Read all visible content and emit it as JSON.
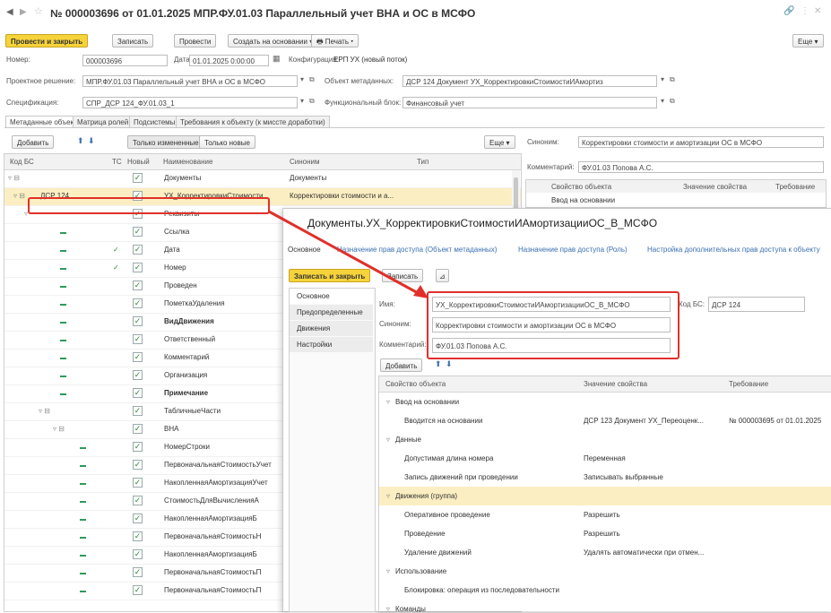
{
  "window": {
    "title": "№ 000003696 от 01.01.2025 МПР.ФУ.01.03 Параллельный учет ВНА и ОС в МСФО",
    "more_label": "Еще ▾"
  },
  "toolbar": {
    "post_close": "Провести и закрыть",
    "save": "Записать",
    "post": "Провести",
    "create_based": "Создать на основании ▾",
    "print": "Печать ▾"
  },
  "header_fields": {
    "number_label": "Номер:",
    "number_value": "000003696",
    "date_label": "Дата:",
    "date_value": "01.01.2025 0:00:00",
    "config_label": "Конфигурация:",
    "config_value": "ЕРП УХ (новый поток)",
    "project_label": "Проектное решение:",
    "project_value": "МПР.ФУ.01.03 Параллельный учет ВНА и ОС в МСФО",
    "metaobject_label": "Объект метаданных:",
    "metaobject_value": "ДСР 124 Документ УХ_КорректировкиСтоимостиИАмортиз",
    "spec_label": "Спецификация:",
    "spec_value": "СПР_ДСР 124_ФУ.01.03_1",
    "functional_block_label": "Функциональный блок:",
    "functional_block_value": "Финансовый учет"
  },
  "tabs": [
    {
      "label": "Метаданные объекта",
      "active": true
    },
    {
      "label": "Матрица ролей",
      "active": false
    },
    {
      "label": "Подсистемы",
      "active": false
    },
    {
      "label": "Требования к объекту (к миссте доработки)",
      "active": false
    }
  ],
  "grid_toolbar": {
    "add": "Добавить",
    "show_changed": "Только измененные",
    "only_new": "Только новые",
    "more": "Еще ▾"
  },
  "grid_headers": {
    "code": "Код БС",
    "ts": "ТС",
    "new": "Новый",
    "name": "Наименование",
    "synonym": "Синоним",
    "type": "Тип"
  },
  "grid_rows": [
    {
      "code": "",
      "mark": "",
      "name": "Документы",
      "synonym": "Документы"
    },
    {
      "code": "ДСР 124",
      "mark": "",
      "name": "УХ_КорректировкиСтоимости",
      "synonym": "Корректировки стоимости и а..."
    },
    {
      "code": "",
      "mark": "",
      "name": "Реквизиты",
      "synonym": ""
    },
    {
      "code": "",
      "mark": "",
      "name": "Ссылка",
      "synonym": ""
    },
    {
      "code": "",
      "mark": "✓",
      "name": "Дата",
      "synonym": ""
    },
    {
      "code": "",
      "mark": "✓",
      "name": "Номер",
      "synonym": ""
    },
    {
      "code": "",
      "mark": "",
      "name": "Проведен",
      "synonym": ""
    },
    {
      "code": "",
      "mark": "",
      "name": "ПометкаУдаления",
      "synonym": ""
    },
    {
      "code": "",
      "mark": "",
      "name": "ВидДвижения",
      "synonym": ""
    },
    {
      "code": "",
      "mark": "",
      "name": "Ответственный",
      "synonym": ""
    },
    {
      "code": "",
      "mark": "",
      "name": "Комментарий",
      "synonym": ""
    },
    {
      "code": "",
      "mark": "",
      "name": "Организация",
      "synonym": ""
    },
    {
      "code": "",
      "mark": "",
      "name": "Примечание",
      "synonym": ""
    },
    {
      "code": "",
      "mark": "",
      "name": "ТабличныеЧасти",
      "synonym": ""
    },
    {
      "code": "",
      "mark": "",
      "name": "ВНА",
      "synonym": ""
    },
    {
      "code": "",
      "mark": "",
      "name": "НомерСтроки",
      "synonym": ""
    },
    {
      "code": "",
      "mark": "",
      "name": "ПервоначальнаяСтоимостьУчет",
      "synonym": ""
    },
    {
      "code": "",
      "mark": "",
      "name": "НакопленнаяАмортизацияУчет",
      "synonym": ""
    },
    {
      "code": "",
      "mark": "",
      "name": "СтоимостьДляВычисленияА",
      "synonym": ""
    },
    {
      "code": "",
      "mark": "",
      "name": "НакопленнаяАмортизацияБ",
      "synonym": ""
    },
    {
      "code": "",
      "mark": "",
      "name": "ПервоначальнаяСтоимостьН",
      "synonym": ""
    },
    {
      "code": "",
      "mark": "",
      "name": "НакопленнаяАмортизацияБ",
      "synonym": ""
    },
    {
      "code": "",
      "mark": "",
      "name": "ПервоначальнаяСтоимостьП",
      "synonym": ""
    },
    {
      "code": "",
      "mark": "",
      "name": "ПервоначальнаяСтоимостьП",
      "synonym": ""
    }
  ],
  "right_panel": {
    "synonym_label": "Синоним:",
    "synonym_value": "Корректировки стоимости и амортизации ОС в МСФО",
    "comment_label": "Комментарий:",
    "comment_value": "ФУ.01.03 Попова А.С.",
    "col_property": "Свойство объекта",
    "col_value": "Значение свойства",
    "col_req": "Требование",
    "first_row": "Ввод на основании"
  },
  "popup": {
    "title": "Документы.УХ_КорректировкиСтоимостиИАмортизацииОС_В_МСФО",
    "links": [
      "Основное",
      "Назначение прав доступа (Объект метаданных)",
      "Назначение прав доступа (Роль)",
      "Настройка дополнительных прав доступа к объекту"
    ],
    "save_close": "Записать и закрыть",
    "save": "Записать",
    "sections": [
      "Основное",
      "Предопределенные",
      "Движения",
      "Настройки"
    ],
    "name_label": "Имя:",
    "name_value": "УХ_КорректировкиСтоимостиИАмортизацииОС_В_МСФО",
    "code_label": "Код БС:",
    "code_value": "ДСР 124",
    "synonym_label": "Синоним:",
    "synonym_value": "Корректировки стоимости и амортизации ОС в МСФО",
    "comment_label": "Комментарий:",
    "comment_value": "ФУ.01.03 Попова А.С.",
    "add": "Добавить",
    "col_property": "Свойство объекта",
    "col_value": "Значение свойства",
    "col_req": "Требование",
    "rows": [
      {
        "level": 0,
        "group": true,
        "prop": "Ввод на основании",
        "value": "",
        "req": ""
      },
      {
        "level": 1,
        "group": false,
        "prop": "Вводится на основании",
        "value": "ДСР 123 Документ УХ_Переоценк...",
        "req": "№ 000003695 от 01.01.2025"
      },
      {
        "level": 0,
        "group": true,
        "prop": "Данные",
        "value": "",
        "req": ""
      },
      {
        "level": 1,
        "group": false,
        "prop": "Допустимая длина номера",
        "value": "Переменная",
        "req": ""
      },
      {
        "level": 1,
        "group": false,
        "prop": "Запись движений при проведении",
        "value": "Записывать выбранные",
        "req": ""
      },
      {
        "level": 0,
        "group": true,
        "prop": "Движения (группа)",
        "value": "",
        "req": "",
        "highlight": true
      },
      {
        "level": 1,
        "group": false,
        "prop": "Оперативное проведение",
        "value": "Разрешить",
        "req": ""
      },
      {
        "level": 1,
        "group": false,
        "prop": "Проведение",
        "value": "Разрешить",
        "req": ""
      },
      {
        "level": 1,
        "group": false,
        "prop": "Удаление движений",
        "value": "Удалять автоматически при отмен...",
        "req": ""
      },
      {
        "level": 0,
        "group": true,
        "prop": "Использование",
        "value": "",
        "req": ""
      },
      {
        "level": 1,
        "group": false,
        "prop": "Блокировка: операция из последовательности",
        "value": "",
        "req": ""
      },
      {
        "level": 0,
        "group": true,
        "prop": "Команды",
        "value": "",
        "req": ""
      }
    ]
  },
  "colors": {
    "accent_yellow": "#f6d33a",
    "highlight_row": "#fbeec2",
    "red_annotation": "#e0302a",
    "check_green": "#2a8a3a"
  }
}
